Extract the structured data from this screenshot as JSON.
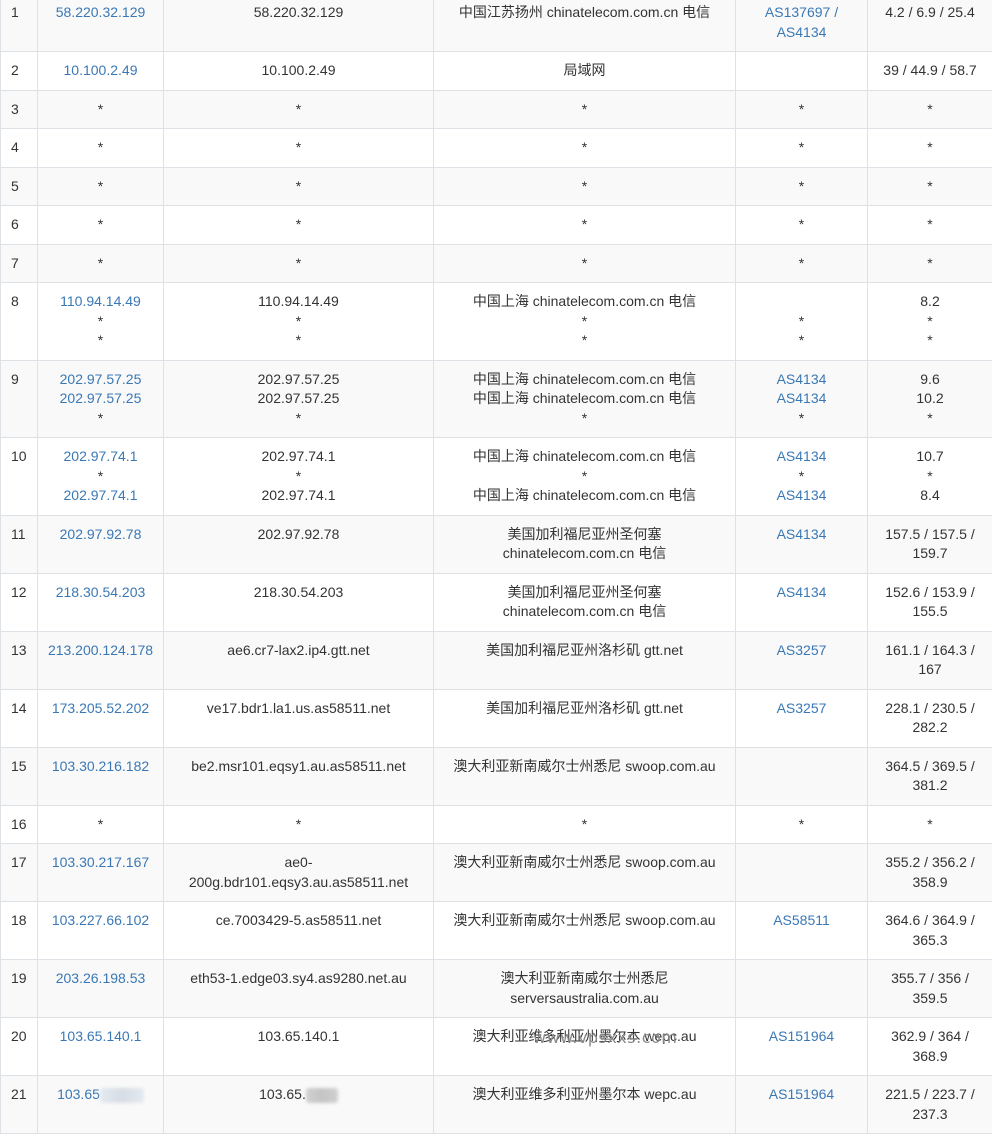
{
  "watermark": "www.vpsxxs.com",
  "colors": {
    "link": "#3a78b5",
    "border": "#dee2e6",
    "stripe": "#f9f9f9"
  },
  "rows": [
    {
      "hop": "1",
      "ip": [
        "58.220.32.129"
      ],
      "host": [
        "58.220.32.129"
      ],
      "loc": [
        "中国江苏扬州 chinatelecom.com.cn 电信"
      ],
      "asn": [
        "AS137697 /",
        "AS4134"
      ],
      "rtt": [
        "4.2 / 6.9 / 25.4"
      ]
    },
    {
      "hop": "2",
      "ip": [
        "10.100.2.49"
      ],
      "host": [
        "10.100.2.49"
      ],
      "loc": [
        "局域网"
      ],
      "asn": [
        ""
      ],
      "rtt": [
        "39 / 44.9 / 58.7"
      ]
    },
    {
      "hop": "3",
      "ip": [
        "*"
      ],
      "host": [
        "*"
      ],
      "loc": [
        "*"
      ],
      "asn": [
        "*"
      ],
      "rtt": [
        "*"
      ]
    },
    {
      "hop": "4",
      "ip": [
        "*"
      ],
      "host": [
        "*"
      ],
      "loc": [
        "*"
      ],
      "asn": [
        "*"
      ],
      "rtt": [
        "*"
      ]
    },
    {
      "hop": "5",
      "ip": [
        "*"
      ],
      "host": [
        "*"
      ],
      "loc": [
        "*"
      ],
      "asn": [
        "*"
      ],
      "rtt": [
        "*"
      ]
    },
    {
      "hop": "6",
      "ip": [
        "*"
      ],
      "host": [
        "*"
      ],
      "loc": [
        "*"
      ],
      "asn": [
        "*"
      ],
      "rtt": [
        "*"
      ]
    },
    {
      "hop": "7",
      "ip": [
        "*"
      ],
      "host": [
        "*"
      ],
      "loc": [
        "*"
      ],
      "asn": [
        "*"
      ],
      "rtt": [
        "*"
      ]
    },
    {
      "hop": "8",
      "ip": [
        "110.94.14.49",
        "*",
        "*"
      ],
      "host": [
        "110.94.14.49",
        "*",
        "*"
      ],
      "loc": [
        "中国上海 chinatelecom.com.cn 电信",
        "*",
        "*"
      ],
      "asn": [
        "",
        "*",
        "*"
      ],
      "rtt": [
        "8.2",
        "*",
        "*"
      ]
    },
    {
      "hop": "9",
      "ip": [
        "202.97.57.25",
        "202.97.57.25",
        "*"
      ],
      "host": [
        "202.97.57.25",
        "202.97.57.25",
        "*"
      ],
      "loc": [
        "中国上海 chinatelecom.com.cn 电信",
        "中国上海 chinatelecom.com.cn 电信",
        "*"
      ],
      "asn": [
        "AS4134",
        "AS4134",
        "*"
      ],
      "rtt": [
        "9.6",
        "10.2",
        "*"
      ]
    },
    {
      "hop": "10",
      "ip": [
        "202.97.74.1",
        "*",
        "202.97.74.1"
      ],
      "host": [
        "202.97.74.1",
        "*",
        "202.97.74.1"
      ],
      "loc": [
        "中国上海 chinatelecom.com.cn 电信",
        "*",
        "中国上海 chinatelecom.com.cn 电信"
      ],
      "asn": [
        "AS4134",
        "*",
        "AS4134"
      ],
      "rtt": [
        "10.7",
        "*",
        "8.4"
      ]
    },
    {
      "hop": "11",
      "ip": [
        "202.97.92.78"
      ],
      "host": [
        "202.97.92.78"
      ],
      "loc": [
        "美国加利福尼亚州圣何塞",
        "chinatelecom.com.cn 电信"
      ],
      "asn": [
        "AS4134"
      ],
      "rtt": [
        "157.5 / 157.5 /",
        "159.7"
      ]
    },
    {
      "hop": "12",
      "ip": [
        "218.30.54.203"
      ],
      "host": [
        "218.30.54.203"
      ],
      "loc": [
        "美国加利福尼亚州圣何塞",
        "chinatelecom.com.cn 电信"
      ],
      "asn": [
        "AS4134"
      ],
      "rtt": [
        "152.6 / 153.9 /",
        "155.5"
      ]
    },
    {
      "hop": "13",
      "ip": [
        "213.200.124.178"
      ],
      "host": [
        "ae6.cr7-lax2.ip4.gtt.net"
      ],
      "loc": [
        "美国加利福尼亚州洛杉矶 gtt.net"
      ],
      "asn": [
        "AS3257"
      ],
      "rtt": [
        "161.1 / 164.3 /",
        "167"
      ]
    },
    {
      "hop": "14",
      "ip": [
        "173.205.52.202"
      ],
      "host": [
        "ve17.bdr1.la1.us.as58511.net"
      ],
      "loc": [
        "美国加利福尼亚州洛杉矶 gtt.net"
      ],
      "asn": [
        "AS3257"
      ],
      "rtt": [
        "228.1 / 230.5 /",
        "282.2"
      ]
    },
    {
      "hop": "15",
      "ip": [
        "103.30.216.182"
      ],
      "host": [
        "be2.msr101.eqsy1.au.as58511.net"
      ],
      "loc": [
        "澳大利亚新南威尔士州悉尼 swoop.com.au"
      ],
      "asn": [
        ""
      ],
      "rtt": [
        "364.5 / 369.5 /",
        "381.2"
      ]
    },
    {
      "hop": "16",
      "ip": [
        "*"
      ],
      "host": [
        "*"
      ],
      "loc": [
        "*"
      ],
      "asn": [
        "*"
      ],
      "rtt": [
        "*"
      ]
    },
    {
      "hop": "17",
      "ip": [
        "103.30.217.167"
      ],
      "host": [
        "ae0-",
        "200g.bdr101.eqsy3.au.as58511.net"
      ],
      "loc": [
        "澳大利亚新南威尔士州悉尼 swoop.com.au"
      ],
      "asn": [
        ""
      ],
      "rtt": [
        "355.2 / 356.2 /",
        "358.9"
      ]
    },
    {
      "hop": "18",
      "ip": [
        "103.227.66.102"
      ],
      "host": [
        "ce.7003429-5.as58511.net"
      ],
      "loc": [
        "澳大利亚新南威尔士州悉尼 swoop.com.au"
      ],
      "asn": [
        "AS58511"
      ],
      "rtt": [
        "364.6 / 364.9 /",
        "365.3"
      ]
    },
    {
      "hop": "19",
      "ip": [
        "203.26.198.53"
      ],
      "host": [
        "eth53-1.edge03.sy4.as9280.net.au"
      ],
      "loc": [
        "澳大利亚新南威尔士州悉尼",
        "serversaustralia.com.au"
      ],
      "asn": [
        ""
      ],
      "rtt": [
        "355.7 / 356 /",
        "359.5"
      ]
    },
    {
      "hop": "20",
      "ip": [
        "103.65.140.1"
      ],
      "host": [
        "103.65.140.1"
      ],
      "loc": [
        "澳大利亚维多利亚州墨尔本 wepc.au"
      ],
      "asn": [
        "AS151964"
      ],
      "rtt": [
        "362.9 / 364 /",
        "368.9"
      ]
    },
    {
      "hop": "21",
      "ip": [
        "103.65"
      ],
      "host": [
        "103.65."
      ],
      "loc": [
        "澳大利亚维多利亚州墨尔本 wepc.au"
      ],
      "asn": [
        "AS151964"
      ],
      "rtt": [
        "221.5 / 223.7 /",
        "237.3"
      ]
    }
  ]
}
